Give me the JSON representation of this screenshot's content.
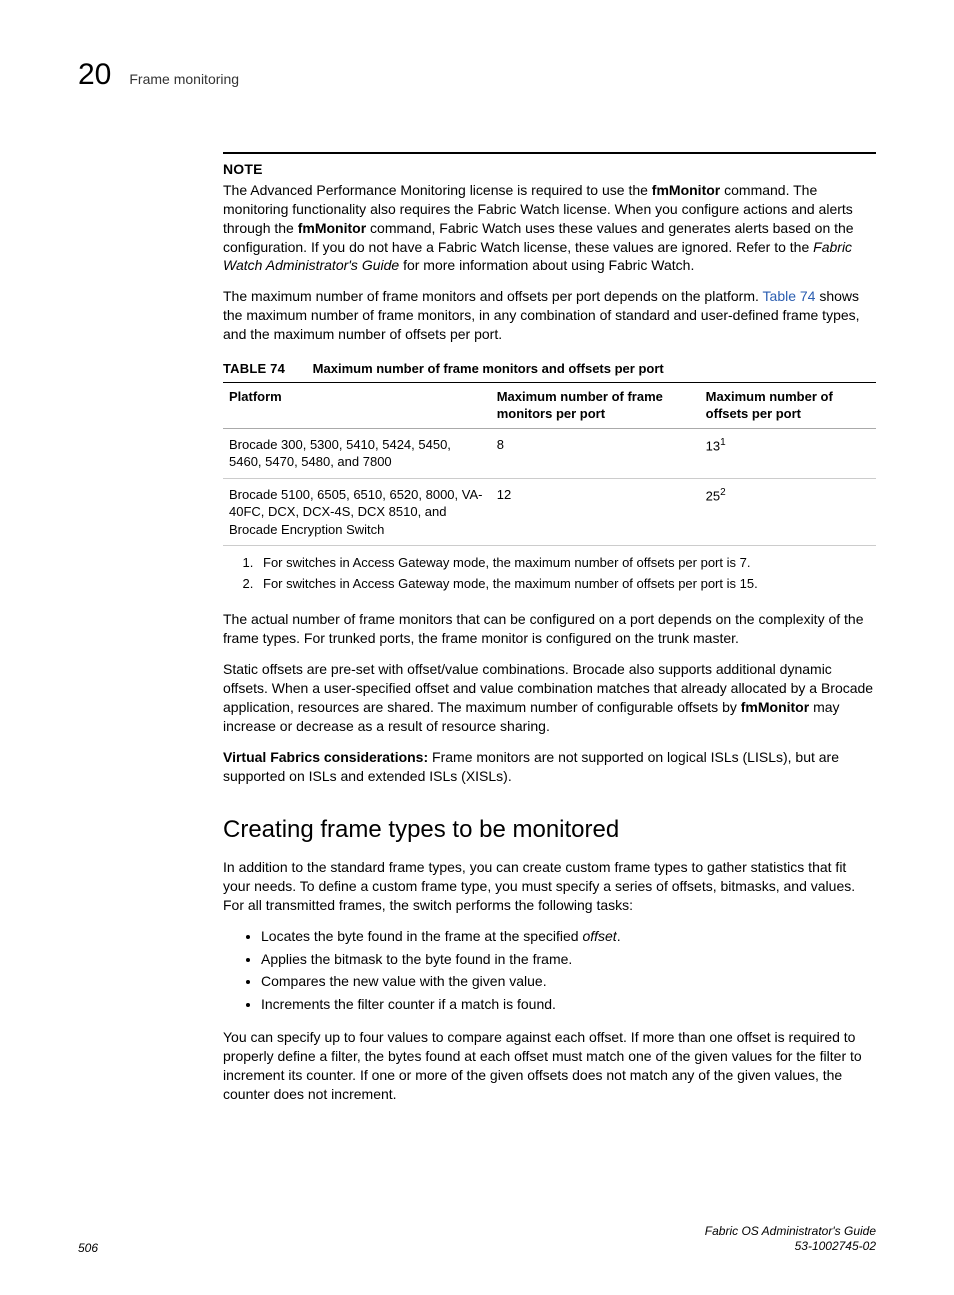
{
  "header": {
    "chapter": "20",
    "section": "Frame monitoring"
  },
  "note": {
    "heading": "NOTE",
    "t1": "The Advanced Performance Monitoring license is required to use the ",
    "cmd1": "fmMonitor",
    "t2": " command. The monitoring functionality also requires the Fabric Watch license. When you configure actions and alerts through the ",
    "cmd2": "fmMonitor",
    "t3": " command, Fabric Watch uses these values and generates alerts based on the configuration. If you do not have a Fabric Watch license, these values are ignored. Refer to the ",
    "ref": "Fabric Watch Administrator's Guide",
    "t4": " for more information about using Fabric Watch."
  },
  "intro_para": {
    "p1a": "The maximum number of frame monitors and offsets per port depends on the platform. ",
    "link": "Table 74",
    "p1b": " shows the maximum number of frame monitors, in any combination of standard and user-defined frame types, and the maximum number of offsets per port."
  },
  "table": {
    "label": "TABLE 74",
    "caption": "Maximum number of frame monitors and offsets per port",
    "headers": {
      "c1": "Platform",
      "c2": "Maximum number of frame monitors per port",
      "c3": "Maximum number of offsets per port"
    },
    "rows": [
      {
        "platform": "Brocade 300, 5300, 5410, 5424, 5450, 5460, 5470, 5480, and 7800",
        "monitors": "8",
        "offsets": "13",
        "fn": "1"
      },
      {
        "platform": "Brocade 5100, 6505, 6510, 6520, 8000, VA-40FC, DCX, DCX-4S, DCX 8510, and Brocade Encryption Switch",
        "monitors": "12",
        "offsets": "25",
        "fn": "2"
      }
    ],
    "footnotes": [
      "For switches in Access Gateway mode, the maximum number of offsets per port is 7.",
      "For switches in Access Gateway mode, the maximum number of offsets per port is 15."
    ]
  },
  "body": {
    "p2": "The actual number of frame monitors that can be configured on a port depends on the complexity of the frame types. For trunked ports, the frame monitor is configured on the trunk master.",
    "p3a": "Static offsets are pre-set with offset/value combinations. Brocade also supports additional dynamic offsets. When a user-specified offset and value combination matches that already allocated by a Brocade application, resources are shared. The maximum number of configurable offsets by ",
    "p3cmd": "fmMonitor",
    "p3b": " may increase or decrease as a result of resource sharing.",
    "p4lead": "Virtual Fabrics considerations:",
    "p4": " Frame monitors are not supported on logical ISLs (LISLs), but are supported on ISLs and extended ISLs (XISLs)."
  },
  "subsection": {
    "heading": "Creating frame types to be monitored",
    "intro": "In addition to the standard frame types, you can create custom frame types to gather statistics that fit your needs. To define a custom frame type, you must specify a series of offsets, bitmasks, and values. For all transmitted frames, the switch performs the following tasks:",
    "bullets": {
      "b1a": "Locates the byte found in the frame at the specified ",
      "b1i": "offset",
      "b1b": ".",
      "b2": "Applies the bitmask to the byte found in the frame.",
      "b3": "Compares the new value with the given value.",
      "b4": "Increments the filter counter if a match is found."
    },
    "after": "You can specify up to four values to compare against each offset. If more than one offset is required to properly define a filter, the bytes found at each offset must match one of the given values for the filter to increment its counter. If one or more of the given offsets does not match any of the given values, the counter does not increment."
  },
  "footer": {
    "page": "506",
    "book": "Fabric OS Administrator's Guide",
    "docnum": "53-1002745-02"
  }
}
